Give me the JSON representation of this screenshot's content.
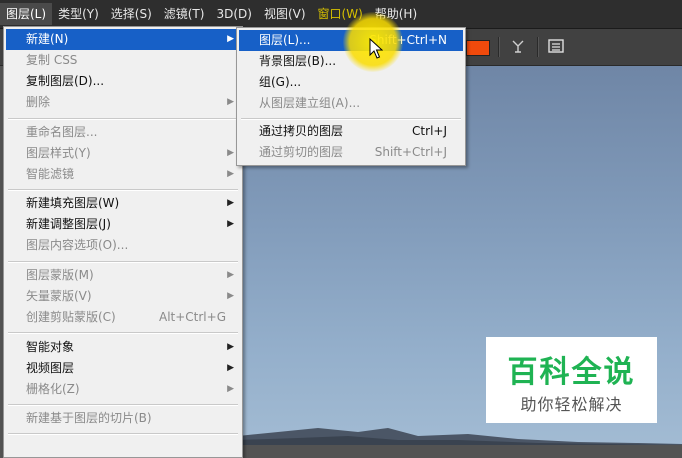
{
  "menubar": [
    {
      "label": "图层(L)",
      "active": true
    },
    {
      "label": "类型(Y)"
    },
    {
      "label": "选择(S)"
    },
    {
      "label": "滤镜(T)"
    },
    {
      "label": "3D(D)"
    },
    {
      "label": "视图(V)"
    },
    {
      "label": "窗口(W)",
      "highlight": true
    },
    {
      "label": "帮助(H)"
    }
  ],
  "layer_menu": {
    "items": [
      {
        "label": "新建(N)",
        "selected": true,
        "submenu": true
      },
      {
        "label": "复制 CSS",
        "disabled": true
      },
      {
        "label": "复制图层(D)..."
      },
      {
        "label": "删除",
        "disabled": true,
        "submenu": true
      },
      {
        "label": "重命名图层...",
        "disabled": true
      },
      {
        "label": "图层样式(Y)",
        "disabled": true,
        "submenu": true
      },
      {
        "label": "智能滤镜",
        "disabled": true,
        "submenu": true
      },
      {
        "label": "新建填充图层(W)",
        "submenu": true
      },
      {
        "label": "新建调整图层(J)",
        "submenu": true
      },
      {
        "label": "图层内容选项(O)...",
        "disabled": true
      },
      {
        "label": "图层蒙版(M)",
        "disabled": true,
        "submenu": true
      },
      {
        "label": "矢量蒙版(V)",
        "disabled": true,
        "submenu": true
      },
      {
        "label": "创建剪贴蒙版(C)",
        "disabled": true,
        "shortcut": "Alt+Ctrl+G"
      },
      {
        "label": "智能对象",
        "submenu": true
      },
      {
        "label": "视频图层",
        "submenu": true
      },
      {
        "label": "栅格化(Z)",
        "disabled": true,
        "submenu": true
      },
      {
        "label": "新建基于图层的切片(B)",
        "disabled": true
      }
    ]
  },
  "new_submenu": {
    "items": [
      {
        "label": "图层(L)...",
        "shortcut": "Shift+Ctrl+N",
        "selected": true
      },
      {
        "label": "背景图层(B)..."
      },
      {
        "label": "组(G)..."
      },
      {
        "label": "从图层建立组(A)...",
        "disabled": true
      },
      {
        "label": "通过拷贝的图层",
        "shortcut": "Ctrl+J"
      },
      {
        "label": "通过剪切的图层",
        "shortcut": "Shift+Ctrl+J",
        "disabled": true
      }
    ]
  },
  "watermark": {
    "title": "百科全说",
    "subtitle": "助你轻松解决"
  },
  "colors": {
    "menu_selected": "#1760c7",
    "foreground_swatch": "#f04a0c",
    "watermark_green": "#1fb353"
  },
  "icons": {
    "submenu_arrow": "chevron-right-icon",
    "pointer": "arrow-cursor-icon"
  }
}
